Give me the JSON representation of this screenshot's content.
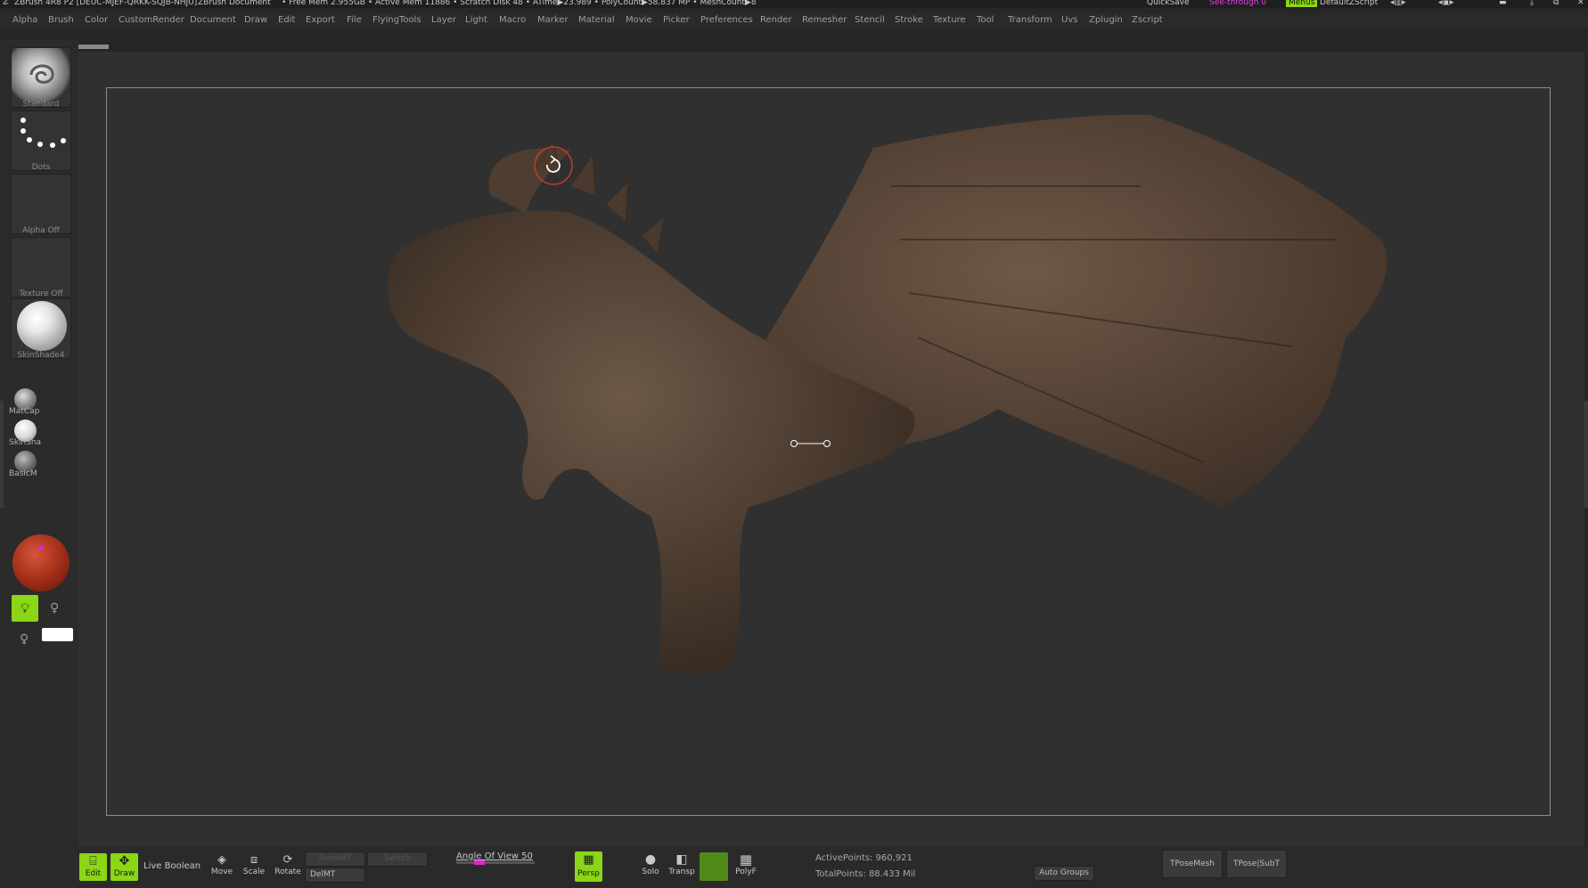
{
  "titlebar": {
    "app": "ZBrush 4R8 P2 [DEUC-MJEF-QRKK-SQJB-NHJU]",
    "document": "ZBrush Document",
    "stats": "• Free Mem 2.955GB • Active Mem 11886 • Scratch Disk 48 • ATime▶23.989 • PolyCount▶58.837 MP • MeshCount▶8",
    "quicksave": "QuickSave",
    "see_through": "See-through 0",
    "menus": "Menus",
    "defaultzscript": "DefaultZScript"
  },
  "menu": [
    "Alpha",
    "Brush",
    "Color",
    "CustomRender",
    "Document",
    "Draw",
    "Edit",
    "Export",
    "File",
    "FlyingTools",
    "Layer",
    "Light",
    "Macro",
    "Marker",
    "Material",
    "Movie",
    "Picker",
    "Preferences",
    "Render",
    "Remesher",
    "Stencil",
    "Stroke",
    "Texture",
    "Tool",
    "Transform",
    "Uvs",
    "Zplugin",
    "Zscript"
  ],
  "tray": {
    "brush": "Standard",
    "stroke": "Dots",
    "alpha": "Alpha Off",
    "texture": "Texture Off",
    "material": "SkinShade4",
    "mat1": "MatCap",
    "mat2": "SkinSha",
    "mat3": "BasicM"
  },
  "bottom": {
    "edit": "Edit",
    "draw": "Draw",
    "live_boolean": "Live Boolean",
    "move": "Move",
    "scale": "Scale",
    "rotate": "Rotate",
    "storemt": "StoreMT",
    "switch": "Switch",
    "delmt": "DelMT",
    "angle_of_view": "Angle Of View 50",
    "persp": "Persp",
    "solo": "Solo",
    "transp": "Transp",
    "polyf": "PolyF",
    "active_points": "ActivePoints: 960,921",
    "total_points": "TotalPoints: 88.433 Mil",
    "auto_groups": "Auto Groups",
    "tposemesh": "TPoseMesh",
    "tpose_subt": "TPose|SubT"
  },
  "colors": {
    "accent": "#8bd616",
    "main_color": "#b0321c"
  }
}
